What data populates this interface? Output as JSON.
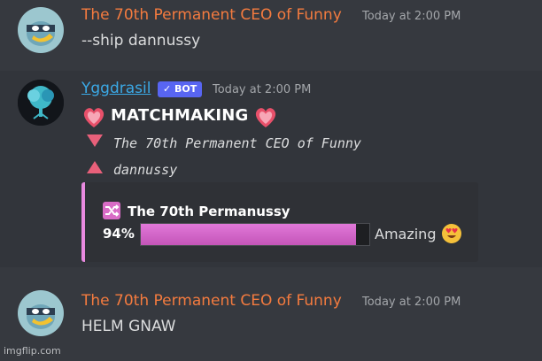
{
  "messages": [
    {
      "author": "The 70th Permanent CEO of Funny",
      "author_color": "#f47b3f",
      "timestamp": "Today at 2:00 PM",
      "text": "--ship dannussy"
    },
    {
      "author": "Yggdrasil",
      "bot_tag": "✓ BOT",
      "timestamp": "Today at 2:00 PM",
      "title": "MATCHMAKING",
      "user_down": "The 70th Permanent CEO of Funny",
      "user_up": "dannussy",
      "embed": {
        "title": "The 70th Permanussy",
        "percent_label": "94%",
        "percent_value": 0.94,
        "rating": "Amazing",
        "accent": "#e98ae0"
      }
    },
    {
      "author": "The 70th Permanent CEO of Funny",
      "author_color": "#f47b3f",
      "timestamp": "Today at 2:00 PM",
      "text": "HELM GNAW"
    }
  ],
  "watermark": "imgflip.com"
}
